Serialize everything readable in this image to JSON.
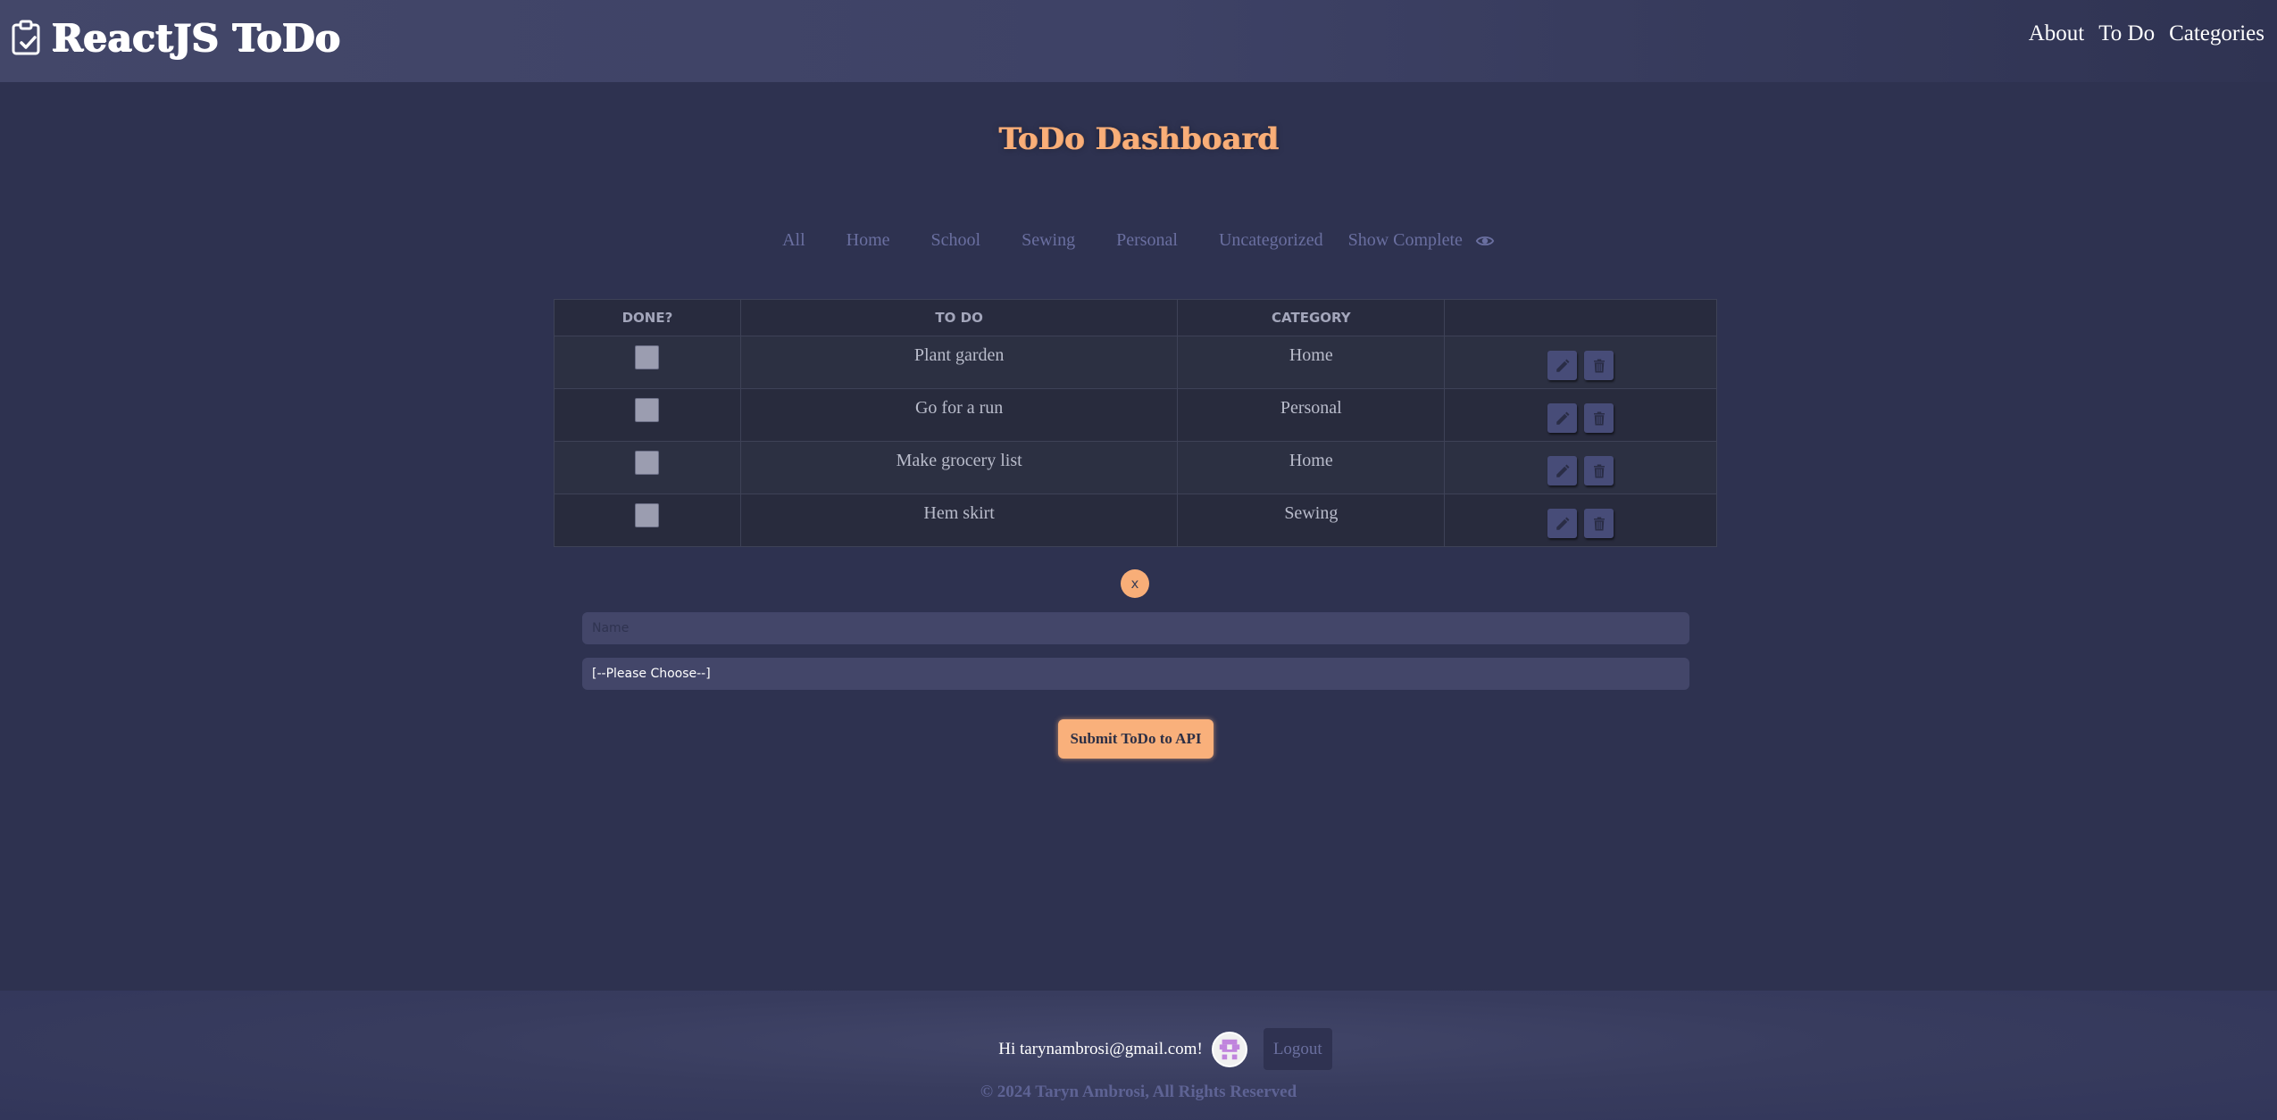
{
  "header": {
    "brand_icon": "clipboard-check-icon",
    "title": "ReactJS ToDo",
    "nav": [
      {
        "label": "About"
      },
      {
        "label": "To Do"
      },
      {
        "label": "Categories"
      }
    ]
  },
  "main": {
    "title": "ToDo Dashboard",
    "filters": [
      {
        "label": "All"
      },
      {
        "label": "Home"
      },
      {
        "label": "School"
      },
      {
        "label": "Sewing"
      },
      {
        "label": "Personal"
      },
      {
        "label": "Uncategorized"
      },
      {
        "label": "Show Complete",
        "icon": "eye-icon"
      }
    ],
    "table": {
      "columns": [
        "DONE?",
        "TO DO",
        "CATEGORY",
        ""
      ],
      "rows": [
        {
          "done": false,
          "todo": "Plant garden",
          "category": "Home"
        },
        {
          "done": false,
          "todo": "Go for a run",
          "category": "Personal"
        },
        {
          "done": false,
          "todo": "Make grocery list",
          "category": "Home"
        },
        {
          "done": false,
          "todo": "Hem skirt",
          "category": "Sewing"
        }
      ],
      "row_actions": [
        "edit-icon",
        "trash-icon"
      ]
    },
    "form": {
      "close_label": "x",
      "name_placeholder": "Name",
      "name_value": "",
      "category_selected": "[--Please Choose--]",
      "submit_label": "Submit ToDo to API"
    }
  },
  "footer": {
    "greeting": "Hi tarynambrosi@gmail.com!",
    "logout_label": "Logout",
    "copyright": "© 2024 Taryn Ambrosi, All Rights Reserved"
  },
  "colors": {
    "accent": "#f9ae78",
    "background": "#2e3250",
    "header": "#434769",
    "input": "#434669"
  }
}
